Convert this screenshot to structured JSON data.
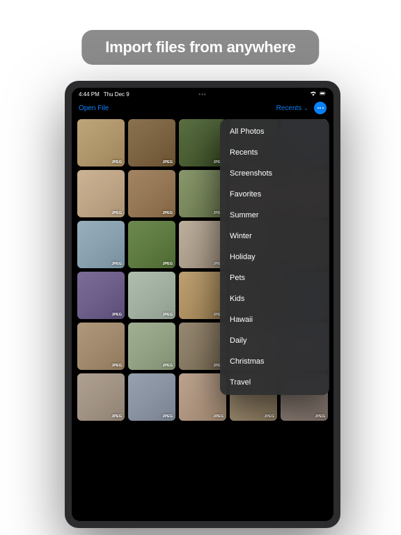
{
  "headline": "Import files from anywhere",
  "status": {
    "time": "4:44 PM",
    "date": "Thu Dec 9"
  },
  "nav": {
    "open_file": "Open File",
    "recents": "Recents"
  },
  "thumb_badge": "JPEG",
  "thumb_colors": [
    "#c4a878",
    "#8b6f4a",
    "#556b3c",
    "#7a8a5a",
    "#6b8a9a",
    "#d4b896",
    "#a68560",
    "#8a9a6a",
    "#c4a080",
    "#b89670",
    "#9ab4c4",
    "#6a8a4a",
    "#c4b4a0",
    "#a8947a",
    "#8a7a5a",
    "#7a6a9a",
    "#b4c4b4",
    "#c4a470",
    "#9a8a6a",
    "#6a7a8a",
    "#b49a7a",
    "#a4b494",
    "#9a8a70",
    "#c4b49a",
    "#8a9aa4",
    "#b4a494",
    "#9aa4b4",
    "#c4a890",
    "#b4a080",
    "#a4948a"
  ],
  "dropdown": [
    "All Photos",
    "Recents",
    "Screenshots",
    "Favorites",
    "Summer",
    "Winter",
    "Holiday",
    "Pets",
    "Kids",
    "Hawaii",
    "Daily",
    "Christmas",
    "Travel"
  ]
}
